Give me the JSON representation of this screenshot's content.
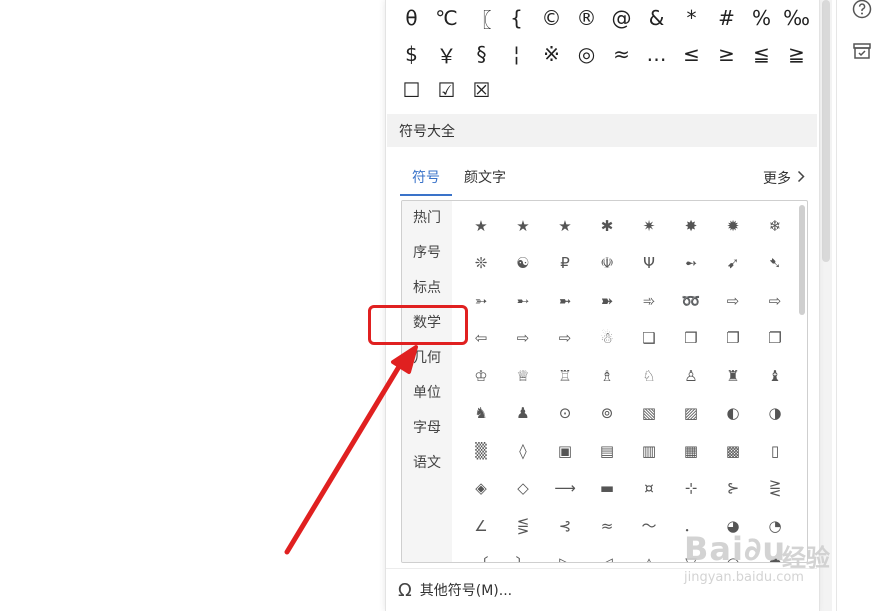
{
  "recent_symbols": [
    "θ",
    "℃",
    "〖",
    "{",
    "©",
    "®",
    "@",
    "&",
    "*",
    "#",
    "%",
    "‰",
    "$",
    "￥",
    "§",
    "¦",
    "※",
    "◎",
    "≈",
    "…",
    "≤",
    "≥",
    "≦",
    "≧",
    "☐",
    "☑",
    "☒"
  ],
  "section_title": "符号大全",
  "tabs": [
    {
      "label": "符号",
      "active": true
    },
    {
      "label": "颜文字",
      "active": false
    }
  ],
  "more_label": "更多",
  "categories": [
    "热门",
    "序号",
    "标点",
    "数学",
    "几何",
    "单位",
    "字母",
    "语文"
  ],
  "symbol_grid": [
    "★",
    "★",
    "★",
    "✱",
    "✷",
    "✸",
    "✹",
    "❄",
    "❊",
    "☯",
    "₽",
    "☫",
    "Ψ",
    "➻",
    "➹",
    "➷",
    "➳",
    "➸",
    "➼",
    "➽",
    "➾",
    "➿",
    "⇨",
    "⇨",
    "⇦",
    "⇨",
    "⇨",
    "☃",
    "❑",
    "❒",
    "❐",
    "❐",
    "♔",
    "♕",
    "♖",
    "♗",
    "♘",
    "♙",
    "♜",
    "♝",
    "♞",
    "♟",
    "⊙",
    "⊚",
    "▧",
    "▨",
    "◐",
    "◑",
    "▒",
    "◊",
    "▣",
    "▤",
    "▥",
    "▦",
    "▩",
    "▯",
    "◈",
    "◇",
    "⟶",
    "▬",
    "¤",
    "⊹",
    "⊱",
    "⋛",
    "∠",
    "⋚",
    "⊰",
    "≈",
    "～",
    "．",
    "◕",
    "◔",
    "〔",
    "〕",
    "▷",
    "◁",
    "△",
    "▽",
    "○",
    "●"
  ],
  "footer_label": "其他符号(M)...",
  "watermark": {
    "brand": "Bai∂u",
    "cn": "经验",
    "url": "jingyan.baidu.com"
  },
  "colors": {
    "accent": "#3a73c9",
    "highlight": "#e02020"
  }
}
